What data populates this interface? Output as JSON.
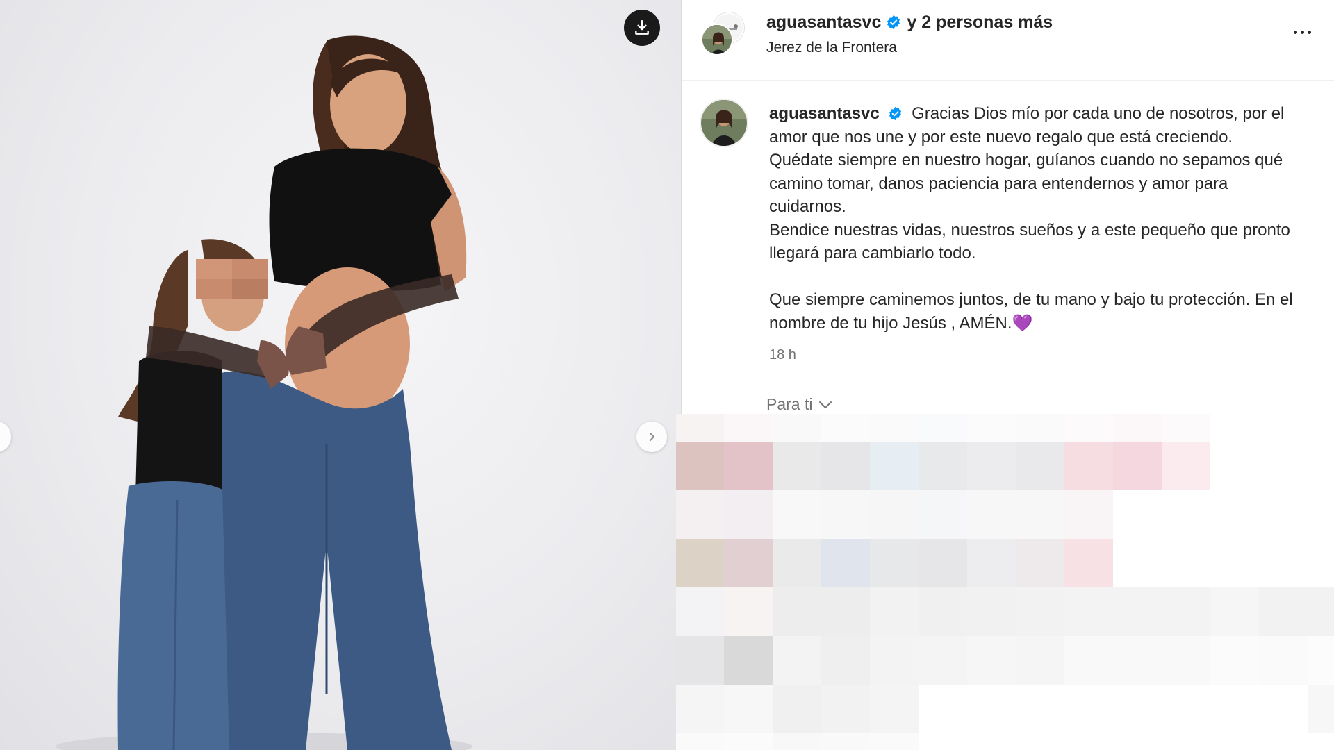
{
  "media": {
    "download_icon": "download-icon",
    "next_icon": "chevron-right-icon"
  },
  "header": {
    "username": "aguasantasvc",
    "verified_icon": "verified-badge-icon",
    "others": "y 2 personas más",
    "location": "Jerez de la Frontera",
    "more_icon": "more-horizontal-icon"
  },
  "post": {
    "username": "aguasantasvc",
    "caption_lines": [
      "Gracias Dios mío por cada uno de nosotros, por el amor que nos une y por este nuevo regalo que está creciendo. Quédate siempre en nuestro hogar, guíanos cuando no sepamos qué camino tomar, danos paciencia para entendernos y amor para cuidarnos.",
      "Bendice nuestras vidas, nuestros sueños y a este pequeño que pronto llegará para cambiarlo todo.",
      "Que siempre caminemos juntos, de tu mano y bajo tu protección. En el nombre de tu hijo Jesús , AMÉN.💜"
    ],
    "time": "18 h",
    "for_you": "Para ti",
    "for_you_icon": "chevron-down-icon"
  },
  "colors": {
    "verified": "#0095f6",
    "secondary_text": "#737373",
    "divider": "#dbdbdb"
  }
}
